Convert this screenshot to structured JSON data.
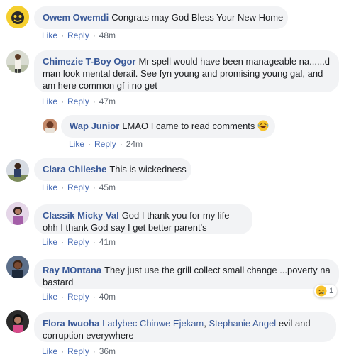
{
  "comments": [
    {
      "name": "Owem Owemdi",
      "text": "Congrats may God Bless Your New Home",
      "like": "Like",
      "reply": "Reply",
      "time": "48m"
    },
    {
      "name": "Chimezie T-Boy Ogor",
      "text": "Mr spell would have been manageable na......d man look mental derail. See fyn young and promising young gal, and am here common gf i no get",
      "like": "Like",
      "reply": "Reply",
      "time": "47m"
    },
    {
      "name": "Wap Junior",
      "text": "LMAO I came to read comments",
      "emoji": "laughing-tears-emoji",
      "like": "Like",
      "reply": "Reply",
      "time": "24m"
    },
    {
      "name": "Clara Chileshe",
      "text": "This is wickedness",
      "like": "Like",
      "reply": "Reply",
      "time": "45m"
    },
    {
      "name": "Classik Micky Val",
      "text": "God I thank you for my life ohh I thank God say I get better parent's",
      "like": "Like",
      "reply": "Reply",
      "time": "41m"
    },
    {
      "name": "Ray MOntana",
      "text": "They just use the grill collect small change ...poverty na bastard",
      "like": "Like",
      "reply": "Reply",
      "time": "40m",
      "reaction": {
        "icon": "sad-reaction-icon",
        "count": "1"
      }
    },
    {
      "name": "Flora Iwuoha",
      "mentions": [
        "Ladybec Chinwe Ejekam",
        "Stephanie Angel"
      ],
      "separator": ",",
      "text": "evil and corruption everywhere",
      "like": "Like",
      "reply": "Reply",
      "time": "36m"
    }
  ],
  "colors": {
    "link": "#385898",
    "bubble": "#f2f3f5",
    "action_link": "#4267b2",
    "meta": "#606770"
  }
}
